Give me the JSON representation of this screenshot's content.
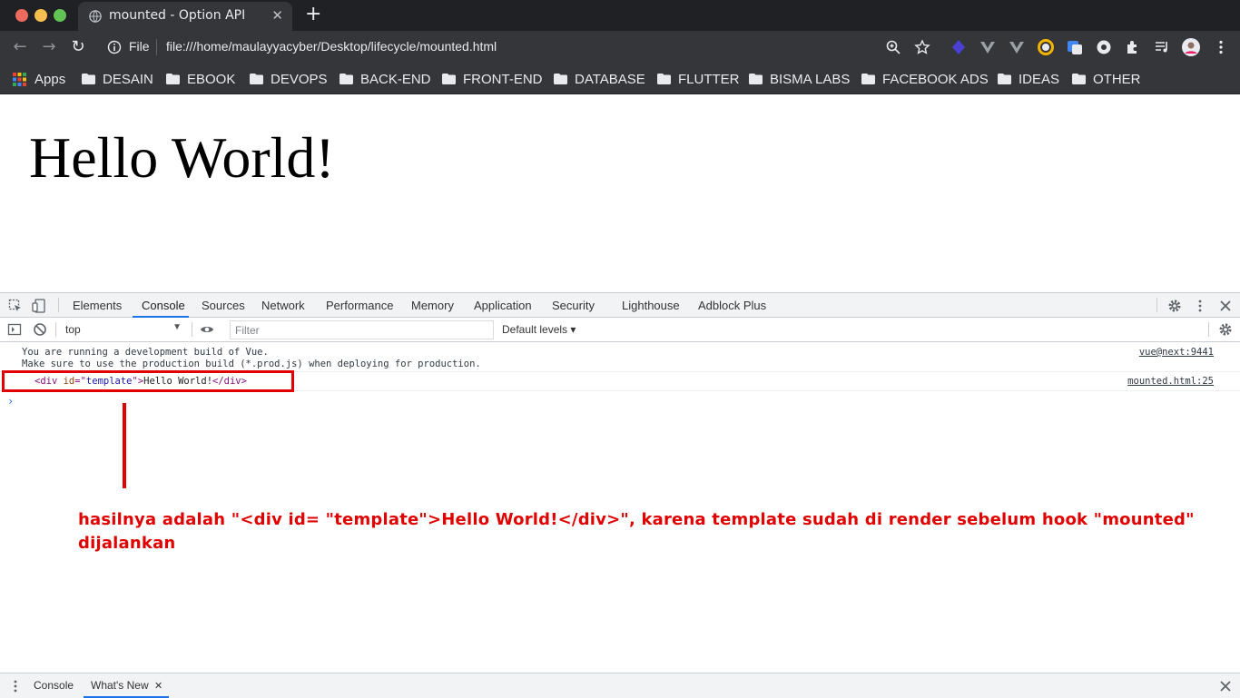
{
  "tab": {
    "title": "mounted - Option API",
    "close": "✕",
    "new_tab": "+"
  },
  "toolbar": {
    "url_prefix": "File",
    "url": "file:///home/maulayyacyber/Desktop/lifecycle/mounted.html"
  },
  "bookmarks": {
    "apps_label": "Apps",
    "items": [
      "DESAIN",
      "EBOOK",
      "DEVOPS",
      "BACK-END",
      "FRONT-END",
      "DATABASE",
      "FLUTTER",
      "BISMA LABS",
      "FACEBOOK ADS",
      "IDEAS",
      "OTHER"
    ]
  },
  "page": {
    "heading": "Hello World!"
  },
  "devtools": {
    "tabs": [
      "Elements",
      "Console",
      "Sources",
      "Network",
      "Performance",
      "Memory",
      "Application",
      "Security",
      "Lighthouse",
      "Adblock Plus"
    ],
    "active_tab": "Console",
    "context": "top",
    "filter_placeholder": "Filter",
    "levels": "Default levels ▾",
    "messages": [
      {
        "line1": "You are running a development build of Vue.",
        "line2": "Make sure to use the production build (*.prod.js) when deploying for production.",
        "source": "vue@next:9441"
      },
      {
        "tag_open": "<div ",
        "attr_name": "id",
        "attr_eq": "=\"",
        "attr_value": "template",
        "attr_close": "\">",
        "text": "Hello World!",
        "tag_close": "</div>",
        "source": "mounted.html:25"
      }
    ],
    "prompt": "›"
  },
  "annotation": {
    "text": "hasilnya adalah \"<div id= \"template\">Hello World!</div>\", karena template sudah di render sebelum hook \"mounted\" dijalankan",
    "color": "#e00000"
  },
  "drawer": {
    "tabs": [
      "Console",
      "What's New"
    ],
    "active": "What's New",
    "close": "✕"
  },
  "colors": {
    "accent": "#1a73e8",
    "chrome_dark": "#202124",
    "chrome_mid": "#35363a"
  }
}
